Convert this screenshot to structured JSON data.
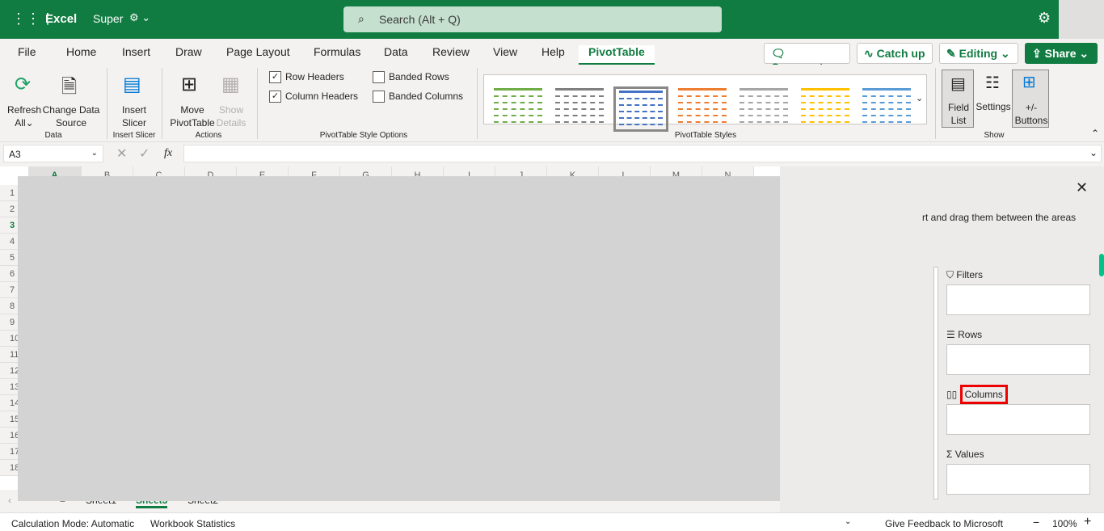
{
  "app": {
    "name": "Excel",
    "file": "Super",
    "search_placeholder": "Search (Alt + Q)"
  },
  "tabs": [
    "File",
    "Home",
    "Insert",
    "Draw",
    "Page Layout",
    "Formulas",
    "Data",
    "Review",
    "View",
    "Help",
    "PivotTable"
  ],
  "top_buttons": {
    "comments": "Comments",
    "catch_up": "Catch up",
    "editing": "Editing",
    "share": "Share"
  },
  "ribbon": {
    "refresh": [
      "Refresh",
      "All"
    ],
    "change": [
      "Change Data",
      "Source"
    ],
    "slicer": [
      "Insert",
      "Slicer"
    ],
    "move": [
      "Move",
      "PivotTable"
    ],
    "show": [
      "Show",
      "Details"
    ],
    "groups": {
      "data": "Data",
      "slicer": "Insert Slicer",
      "actions": "Actions",
      "options": "PivotTable Style Options",
      "styles": "PivotTable Styles",
      "show": "Show"
    },
    "options": {
      "row_headers": "Row Headers",
      "column_headers": "Column Headers",
      "banded_rows": "Banded Rows",
      "banded_columns": "Banded Columns"
    },
    "checked": {
      "row_headers": true,
      "column_headers": true,
      "banded_rows": false,
      "banded_columns": false
    },
    "style_colors": [
      "#70ad47",
      "#7f7f7f",
      "#4472c4",
      "#ed7d31",
      "#a5a5a5",
      "#ffc000",
      "#5b9bd5"
    ],
    "field_list": [
      "Field",
      "List"
    ],
    "settings": "Settings",
    "buttons": [
      "+/-",
      "Buttons"
    ]
  },
  "formula": {
    "name_box": "A3",
    "fx": "fx",
    "value": ""
  },
  "columns": [
    "A",
    "B",
    "C",
    "D",
    "E",
    "F",
    "G",
    "H",
    "I",
    "J",
    "K",
    "L",
    "M",
    "N"
  ],
  "rows": [
    "1",
    "2",
    "3",
    "4",
    "5",
    "6",
    "7",
    "8",
    "9",
    "10",
    "11",
    "12",
    "13",
    "14",
    "15",
    "16",
    "17",
    "18"
  ],
  "sheets": [
    "Sheet1",
    "Sheet3",
    "Sheet2"
  ],
  "pane": {
    "hint": "rt and drag them between the areas",
    "filters": "Filters",
    "rows": "Rows",
    "columns": "Columns",
    "values": "Values"
  },
  "status": {
    "calc": "Calculation Mode: Automatic",
    "stats": "Workbook Statistics",
    "feedback": "Give Feedback to Microsoft",
    "zoom": "100%"
  }
}
